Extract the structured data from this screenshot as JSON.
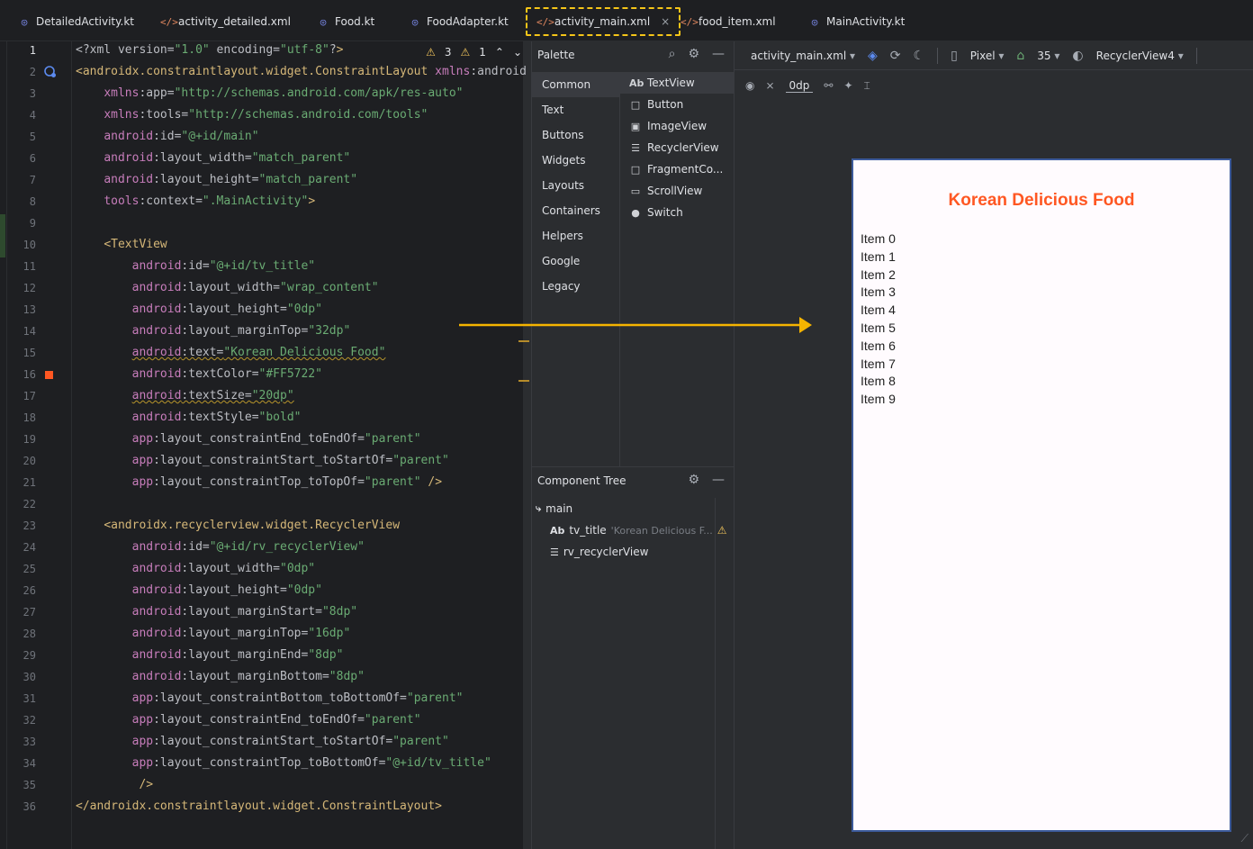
{
  "tabs": [
    {
      "label": "DetailedActivity.kt",
      "type": "kt"
    },
    {
      "label": "activity_detailed.xml",
      "type": "xml"
    },
    {
      "label": "Food.kt",
      "type": "kt"
    },
    {
      "label": "FoodAdapter.kt",
      "type": "kt"
    },
    {
      "label": "activity_main.xml",
      "type": "xml",
      "active": true
    },
    {
      "label": "food_item.xml",
      "type": "xml"
    },
    {
      "label": "MainActivity.kt",
      "type": "kt"
    }
  ],
  "tab_close_glyph": "×",
  "inspections": {
    "warnings": "3",
    "weak_warnings": "1"
  },
  "editor_lines": [
    "<?xml version=\"1.0\" encoding=\"utf-8\"?>",
    "<androidx.constraintlayout.widget.ConstraintLayout xmlns:android",
    "    xmlns:app=\"http://schemas.android.com/apk/res-auto\"",
    "    xmlns:tools=\"http://schemas.android.com/tools\"",
    "    android:id=\"@+id/main\"",
    "    android:layout_width=\"match_parent\"",
    "    android:layout_height=\"match_parent\"",
    "    tools:context=\".MainActivity\">",
    "",
    "    <TextView",
    "        android:id=\"@+id/tv_title\"",
    "        android:layout_width=\"wrap_content\"",
    "        android:layout_height=\"0dp\"",
    "        android:layout_marginTop=\"32dp\"",
    "        android:text=\"Korean Delicious Food\"",
    "        android:textColor=\"#FF5722\"",
    "        android:textSize=\"20dp\"",
    "        android:textStyle=\"bold\"",
    "        app:layout_constraintEnd_toEndOf=\"parent\"",
    "        app:layout_constraintStart_toStartOf=\"parent\"",
    "        app:layout_constraintTop_toTopOf=\"parent\" />",
    "",
    "    <androidx.recyclerview.widget.RecyclerView",
    "        android:id=\"@+id/rv_recyclerView\"",
    "        android:layout_width=\"0dp\"",
    "        android:layout_height=\"0dp\"",
    "        android:layout_marginStart=\"8dp\"",
    "        android:layout_marginTop=\"16dp\"",
    "        android:layout_marginEnd=\"8dp\"",
    "        android:layout_marginBottom=\"8dp\"",
    "        app:layout_constraintBottom_toBottomOf=\"parent\"",
    "        app:layout_constraintEnd_toEndOf=\"parent\"",
    "        app:layout_constraintStart_toStartOf=\"parent\"",
    "        app:layout_constraintTop_toBottomOf=\"@+id/tv_title\"",
    "         />",
    "</androidx.constraintlayout.widget.ConstraintLayout>"
  ],
  "palette": {
    "title": "Palette",
    "categories": [
      "Common",
      "Text",
      "Buttons",
      "Widgets",
      "Layouts",
      "Containers",
      "Helpers",
      "Google",
      "Legacy"
    ],
    "items": [
      {
        "label": "TextView",
        "icon": "Ab"
      },
      {
        "label": "Button",
        "icon": "□"
      },
      {
        "label": "ImageView",
        "icon": "▣"
      },
      {
        "label": "RecyclerView",
        "icon": "☰"
      },
      {
        "label": "FragmentCo...",
        "icon": "□"
      },
      {
        "label": "ScrollView",
        "icon": "▭"
      },
      {
        "label": "Switch",
        "icon": "●"
      }
    ]
  },
  "component_tree": {
    "title": "Component Tree",
    "nodes": [
      {
        "label": "main",
        "icon": "⤷"
      },
      {
        "label": "tv_title",
        "icon": "Ab",
        "hint": "'Korean Delicious F..."
      },
      {
        "label": "rv_recyclerView",
        "icon": "☰"
      }
    ]
  },
  "design_toolbar": {
    "file": "activity_main.xml",
    "device": "Pixel",
    "api": "35",
    "theme": "RecyclerView4",
    "margin": "0dp"
  },
  "preview": {
    "title": "Korean Delicious Food",
    "title_color": "#FF5722",
    "items": [
      "Item 0",
      "Item 1",
      "Item 2",
      "Item 3",
      "Item 4",
      "Item 5",
      "Item 6",
      "Item 7",
      "Item 8",
      "Item 9"
    ]
  }
}
